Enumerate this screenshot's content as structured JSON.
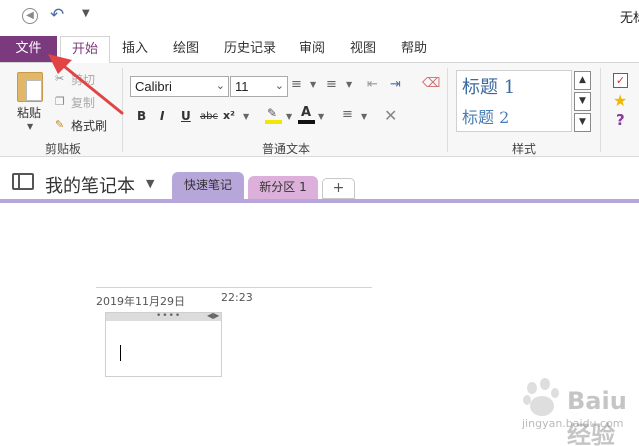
{
  "window": {
    "title": "无标"
  },
  "quick_access": {
    "back_icon": "back-circle-icon",
    "undo_icon": "undo-icon",
    "customize_icon": "customize-dropdown-icon"
  },
  "ribbon": {
    "tabs": [
      "文件",
      "开始",
      "插入",
      "绘图",
      "历史记录",
      "审阅",
      "视图",
      "帮助"
    ],
    "active_tab": "开始",
    "file_tab_color": "#7b3a7e",
    "clipboard": {
      "paste_label": "粘贴",
      "cut_label": "剪切",
      "copy_label": "复制",
      "format_painter_label": "格式刷",
      "group_label": "剪贴板"
    },
    "font": {
      "font_name": "Calibri",
      "font_size": "11",
      "bold": "B",
      "italic": "I",
      "underline": "U",
      "strikethrough": "abc",
      "superscript": "x²",
      "group_label": "普通文本"
    },
    "styles": {
      "heading1": "标题 1",
      "heading2": "标题 2",
      "group_label": "样式"
    }
  },
  "notebook": {
    "name": "我的笔记本",
    "sections": [
      {
        "label": "快速笔记",
        "color": "#b7a6d9"
      },
      {
        "label": "新分区 1",
        "color": "#dcb0da"
      }
    ],
    "add_section_label": "+"
  },
  "page": {
    "date": "2019年11月29日",
    "time": "22:23"
  },
  "watermark": {
    "text": "Baiu经验",
    "subtext": "jingyan.baidu.com"
  },
  "annotation": {
    "arrow_color": "#e04444"
  }
}
